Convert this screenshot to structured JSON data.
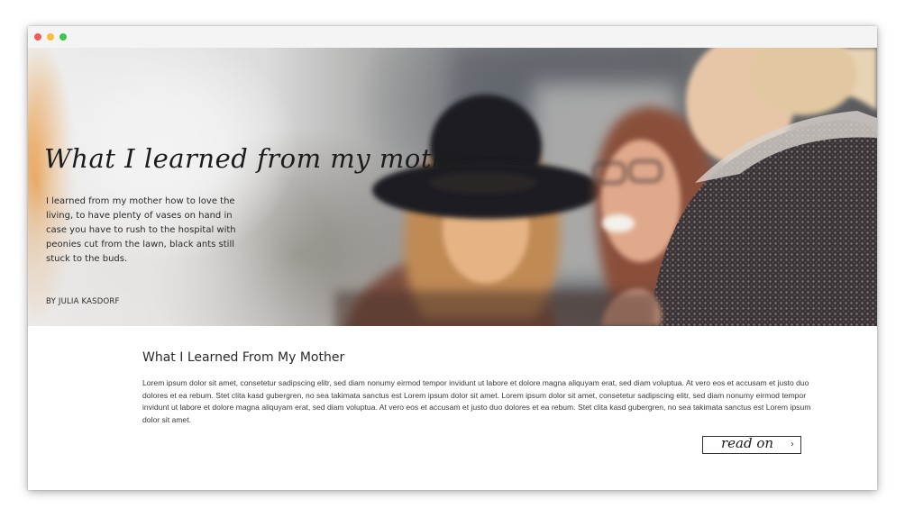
{
  "window": {
    "controls": [
      "close-dot",
      "minimize-dot",
      "zoom-dot"
    ]
  },
  "hero": {
    "title": "What I learned from my mother",
    "description": "I learned from my mother how to love the living, to have plenty of vases on hand in case you have to rush to the hospital with peonies cut from the lawn, black ants still stuck to the buds.",
    "byline": "BY JULIA KASDORF",
    "image_alt": "three laughing women"
  },
  "article": {
    "title": "What I Learned From My Mother",
    "body": "Lorem ipsum dolor sit amet, consetetur sadipscing elitr, sed diam nonumy eirmod tempor invidunt ut labore et dolore magna aliquyam erat, sed diam voluptua. At vero eos et accusam et justo duo dolores et ea rebum. Stet clita kasd gubergren, no sea takimata sanctus est Lorem ipsum dolor sit amet. Lorem ipsum dolor sit amet, consetetur sadipscing elitr, sed diam nonumy eirmod tempor invidunt ut labore et dolore magna aliquyam erat, sed diam voluptua. At vero eos et accusam et justo duo dolores et ea rebum. Stet clita kasd gubergren, no sea takimata sanctus est Lorem ipsum dolor sit amet.",
    "read_on_label": "read on",
    "read_on_icon": "chevron-right-icon"
  }
}
